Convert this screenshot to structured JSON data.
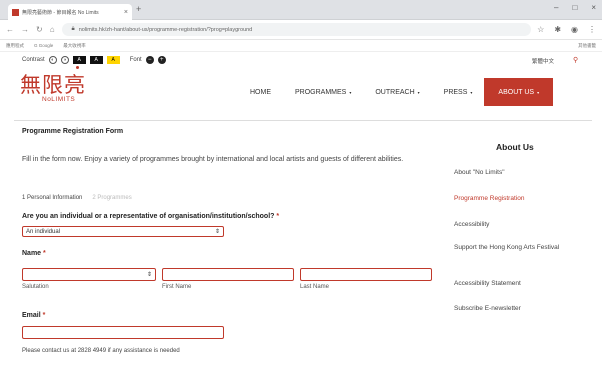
{
  "browser": {
    "tab_title": "無限亮藝術節 - 節目報名 No Limits",
    "tab_close": "×",
    "new_tab": "+",
    "url": "nolimits.hk/zh-hant/about-us/programme-registration/?prog=playground",
    "bookmarks": [
      "應用程式",
      "G Google",
      "最大收視率"
    ],
    "bookmarks_right": "其他書籤",
    "window_controls": [
      "–",
      "□",
      "×"
    ]
  },
  "accessibility": {
    "contrast_label": "Contrast",
    "font_label": "Font",
    "swatches": [
      "A",
      "A",
      "A"
    ]
  },
  "lang_toggle": "繁體中文",
  "logo": {
    "cn": "無限亮",
    "en": "NoLIMITS"
  },
  "nav": {
    "items": [
      {
        "label": "HOME",
        "has_arrow": false
      },
      {
        "label": "PROGRAMMES",
        "has_arrow": true
      },
      {
        "label": "OUTREACH",
        "has_arrow": true
      },
      {
        "label": "PRESS",
        "has_arrow": true
      },
      {
        "label": "ABOUT US",
        "has_arrow": true
      }
    ],
    "arrow": "▾"
  },
  "form": {
    "title": "Programme Registration Form",
    "intro": "Fill in the form now. Enjoy a variety of programmes brought by international and local artists and guests of different abilities.",
    "steps": [
      "1 Personal Information",
      "2 Programmes"
    ],
    "q_individual": "Are you an individual or a representative of organisation/institution/school?",
    "q_individual_value": "An individual",
    "name_label": "Name",
    "salutation_label": "Salutation",
    "first_name_label": "First Name",
    "last_name_label": "Last Name",
    "email_label": "Email",
    "required_mark": "*",
    "contact_note": "Please contact us at 2828 4949 if any assistance is needed"
  },
  "sidebar": {
    "title": "About Us",
    "items": [
      {
        "label": "About \"No Limits\"",
        "current": false
      },
      {
        "label": "Programme Registration",
        "current": true
      },
      {
        "label": "Accessibility",
        "current": false
      },
      {
        "label": "Support the Hong Kong Arts Festival",
        "current": false
      },
      {
        "label": "Accessibility Statement",
        "current": false
      },
      {
        "label": "Subscribe E-newsletter",
        "current": false
      }
    ]
  },
  "colors": {
    "brand": "#c0392b",
    "contrast_yellow": "#ffd400"
  }
}
